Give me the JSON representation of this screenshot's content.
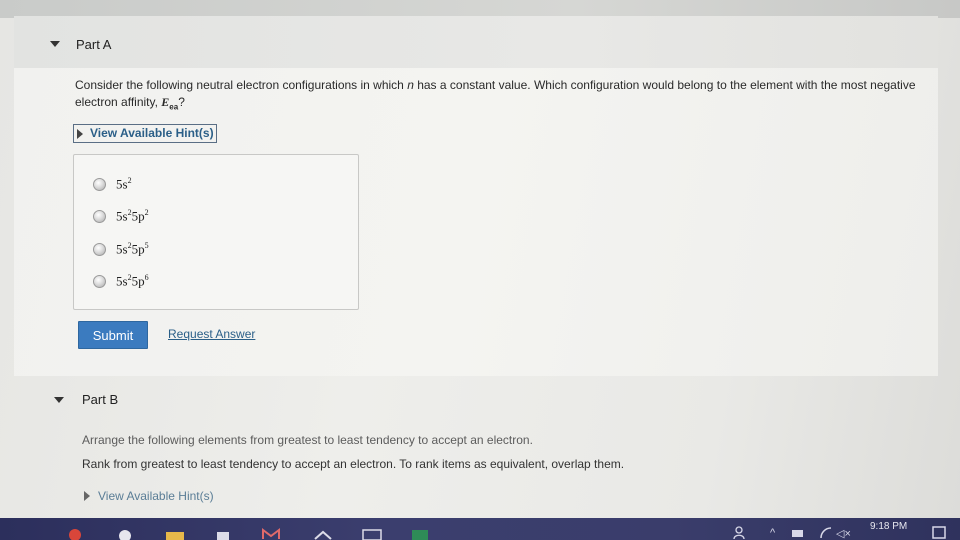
{
  "part_a": {
    "title": "Part A",
    "question_start": "Consider the following neutral electron configurations in which ",
    "question_var": "n",
    "question_mid": " has a constant value. Which configuration would belong to the element with the most negative electron affinity, ",
    "question_symbol": "E",
    "question_subscript": "ea",
    "question_end": "?",
    "hint_label": "View Available Hint(s)",
    "options": [
      {
        "base": "5s",
        "sup": "2",
        "base2": "",
        "sup2": ""
      },
      {
        "base": "5s",
        "sup": "2",
        "base2": "5p",
        "sup2": "2"
      },
      {
        "base": "5s",
        "sup": "2",
        "base2": "5p",
        "sup2": "5"
      },
      {
        "base": "5s",
        "sup": "2",
        "base2": "5p",
        "sup2": "6"
      }
    ],
    "submit_label": "Submit",
    "request_label": "Request Answer"
  },
  "part_b": {
    "title": "Part B",
    "arrange_text": "Arrange the following elements from greatest to least tendency to accept an electron.",
    "rank_text": "Rank from greatest to least tendency to accept an electron. To rank items as equivalent, overlap them.",
    "hint_label": "View Available Hint(s)"
  },
  "taskbar": {
    "clock": "9:18 PM"
  },
  "colors": {
    "accent": "#3b7bbf",
    "link": "#2b5f88",
    "taskbar": "#33365f"
  }
}
